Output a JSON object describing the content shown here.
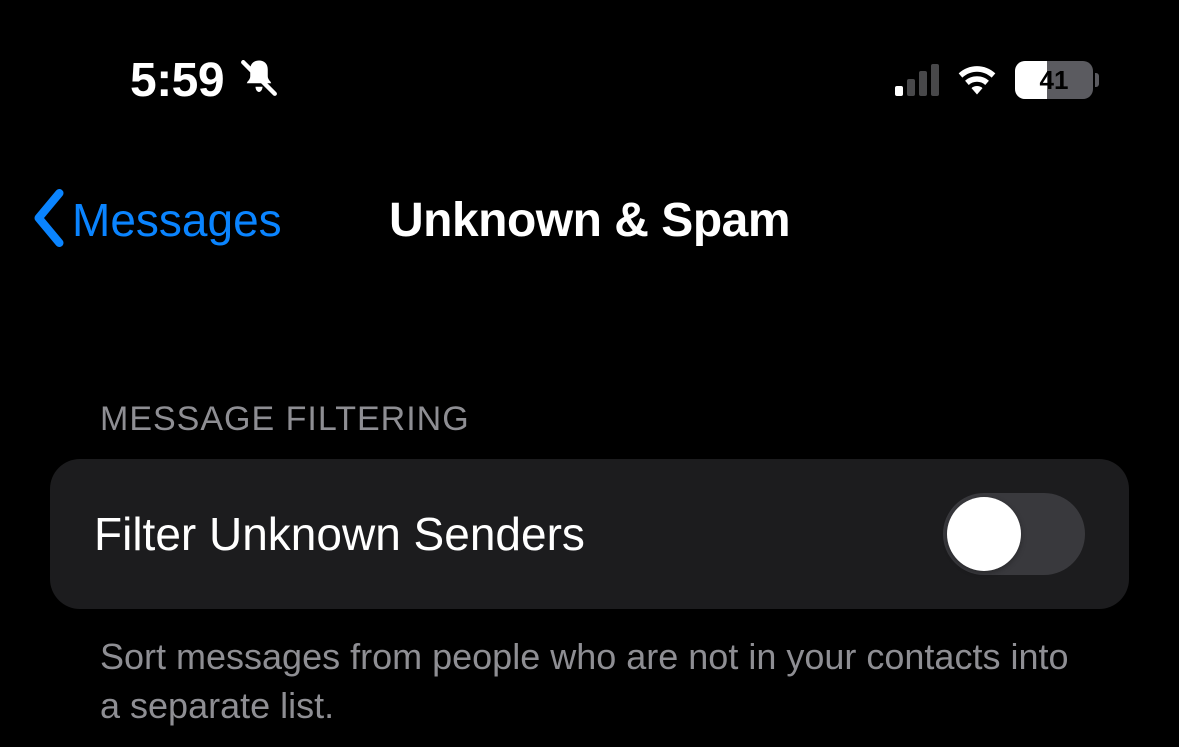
{
  "status_bar": {
    "time": "5:59",
    "battery_percent": "41",
    "battery_fill_percent": 41,
    "cellular_bars_active": 1
  },
  "nav": {
    "back_label": "Messages",
    "title": "Unknown & Spam"
  },
  "section": {
    "header": "MESSAGE FILTERING",
    "row_label": "Filter Unknown Senders",
    "toggle_on": false,
    "footer": "Sort messages from people who are not in your contacts into a separate list."
  },
  "colors": {
    "accent": "#0a84ff",
    "cell_bg": "#1c1c1e",
    "secondary_text": "#8e8e93"
  }
}
